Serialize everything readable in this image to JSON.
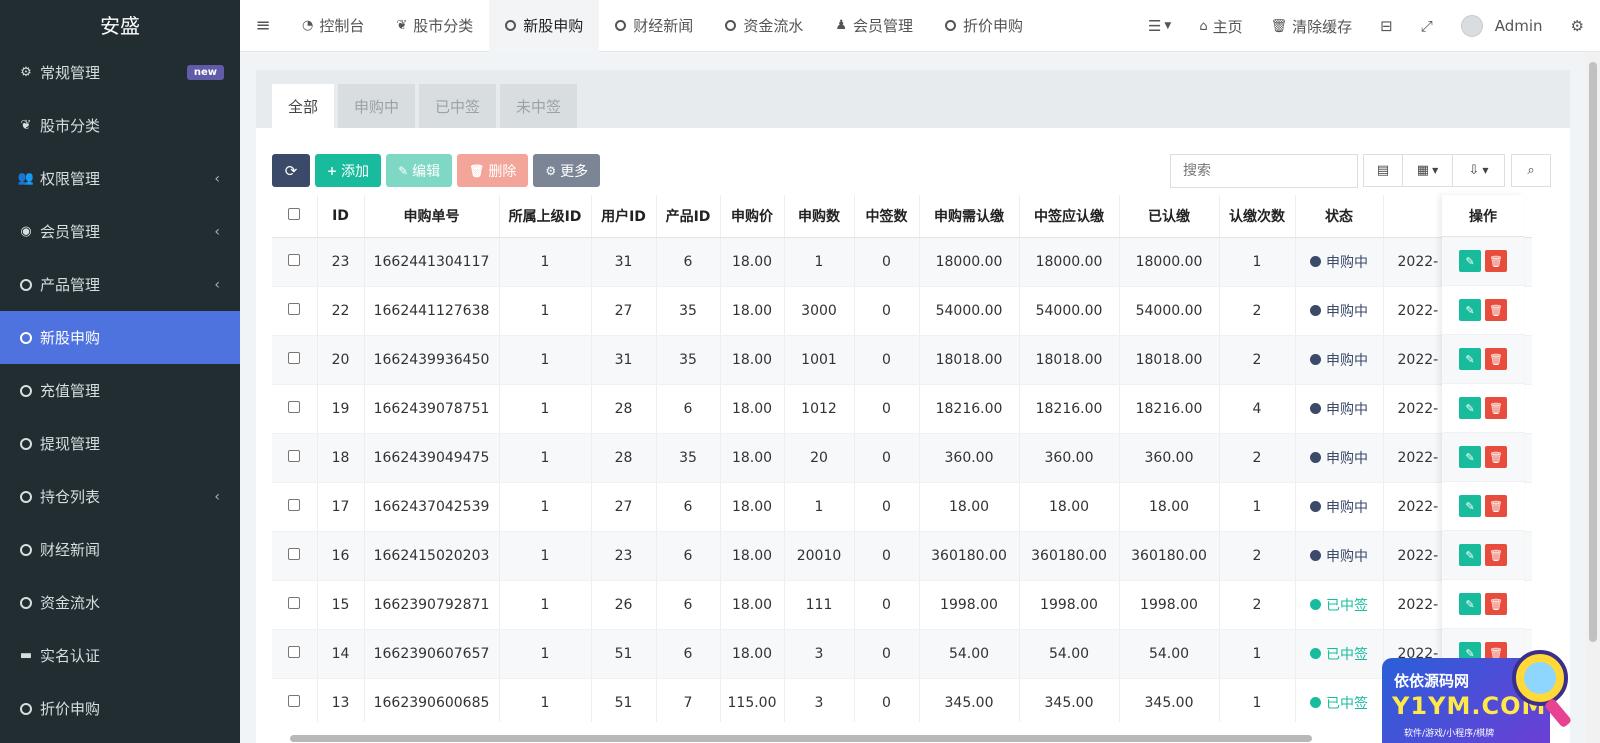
{
  "sidebar": {
    "brand": "安盛",
    "items": [
      {
        "label": "常规管理",
        "icon": "cogs-icon",
        "badge": "new"
      },
      {
        "label": "股市分类",
        "icon": "leaf-icon"
      },
      {
        "label": "权限管理",
        "icon": "group-icon",
        "chevron": true
      },
      {
        "label": "会员管理",
        "icon": "user-circle-icon",
        "chevron": true
      },
      {
        "label": "产品管理",
        "icon": "circle-o-icon",
        "chevron": true
      },
      {
        "label": "新股申购",
        "icon": "circle-o-icon",
        "active": true
      },
      {
        "label": "充值管理",
        "icon": "circle-o-icon"
      },
      {
        "label": "提现管理",
        "icon": "circle-o-icon"
      },
      {
        "label": "持仓列表",
        "icon": "circle-o-icon",
        "chevron": true
      },
      {
        "label": "财经新闻",
        "icon": "circle-o-icon"
      },
      {
        "label": "资金流水",
        "icon": "circle-o-icon"
      },
      {
        "label": "实名认证",
        "icon": "credit-card-icon"
      },
      {
        "label": "折价申购",
        "icon": "circle-o-icon"
      }
    ]
  },
  "topnav": {
    "tabs": [
      {
        "label": "控制台",
        "icon": "dashboard-icon"
      },
      {
        "label": "股市分类",
        "icon": "leaf-icon"
      },
      {
        "label": "新股申购",
        "icon": "circle-o-icon",
        "active": true
      },
      {
        "label": "财经新闻",
        "icon": "circle-o-icon"
      },
      {
        "label": "资金流水",
        "icon": "circle-o-icon"
      },
      {
        "label": "会员管理",
        "icon": "user-icon"
      },
      {
        "label": "折价申购",
        "icon": "circle-o-icon"
      }
    ],
    "home_label": "主页",
    "clear_cache_label": "清除缓存",
    "admin_label": "Admin"
  },
  "page_tabs": [
    "全部",
    "申购中",
    "已中签",
    "未中签"
  ],
  "toolbar": {
    "add_label": "添加",
    "edit_label": "编辑",
    "delete_label": "删除",
    "more_label": "更多",
    "search_placeholder": "搜索"
  },
  "table": {
    "columns": [
      "ID",
      "申购单号",
      "所属上级ID",
      "用户ID",
      "产品ID",
      "申购价",
      "申购数",
      "中签数",
      "申购需认缴",
      "中签应认缴",
      "已认缴",
      "认缴次数",
      "状态",
      ""
    ],
    "op_header": "操作",
    "rows": [
      {
        "id": "23",
        "no": "1662441304117",
        "parent": "1",
        "uid": "31",
        "pid": "6",
        "price": "18.00",
        "qty": "1",
        "won": "0",
        "need": "18000.00",
        "should": "18000.00",
        "paid": "18000.00",
        "times": "1",
        "status": "申购中",
        "status_type": "pending",
        "time": "2022-"
      },
      {
        "id": "22",
        "no": "1662441127638",
        "parent": "1",
        "uid": "27",
        "pid": "35",
        "price": "18.00",
        "qty": "3000",
        "won": "0",
        "need": "54000.00",
        "should": "54000.00",
        "paid": "54000.00",
        "times": "2",
        "status": "申购中",
        "status_type": "pending",
        "time": "2022-"
      },
      {
        "id": "20",
        "no": "1662439936450",
        "parent": "1",
        "uid": "31",
        "pid": "35",
        "price": "18.00",
        "qty": "1001",
        "won": "0",
        "need": "18018.00",
        "should": "18018.00",
        "paid": "18018.00",
        "times": "2",
        "status": "申购中",
        "status_type": "pending",
        "time": "2022-"
      },
      {
        "id": "19",
        "no": "1662439078751",
        "parent": "1",
        "uid": "28",
        "pid": "6",
        "price": "18.00",
        "qty": "1012",
        "won": "0",
        "need": "18216.00",
        "should": "18216.00",
        "paid": "18216.00",
        "times": "4",
        "status": "申购中",
        "status_type": "pending",
        "time": "2022-"
      },
      {
        "id": "18",
        "no": "1662439049475",
        "parent": "1",
        "uid": "28",
        "pid": "35",
        "price": "18.00",
        "qty": "20",
        "won": "0",
        "need": "360.00",
        "should": "360.00",
        "paid": "360.00",
        "times": "2",
        "status": "申购中",
        "status_type": "pending",
        "time": "2022-"
      },
      {
        "id": "17",
        "no": "1662437042539",
        "parent": "1",
        "uid": "27",
        "pid": "6",
        "price": "18.00",
        "qty": "1",
        "won": "0",
        "need": "18.00",
        "should": "18.00",
        "paid": "18.00",
        "times": "1",
        "status": "申购中",
        "status_type": "pending",
        "time": "2022-"
      },
      {
        "id": "16",
        "no": "1662415020203",
        "parent": "1",
        "uid": "23",
        "pid": "6",
        "price": "18.00",
        "qty": "20010",
        "won": "0",
        "need": "360180.00",
        "should": "360180.00",
        "paid": "360180.00",
        "times": "2",
        "status": "申购中",
        "status_type": "pending",
        "time": "2022-"
      },
      {
        "id": "15",
        "no": "1662390792871",
        "parent": "1",
        "uid": "26",
        "pid": "6",
        "price": "18.00",
        "qty": "111",
        "won": "0",
        "need": "1998.00",
        "should": "1998.00",
        "paid": "1998.00",
        "times": "2",
        "status": "已中签",
        "status_type": "won",
        "time": "2022-"
      },
      {
        "id": "14",
        "no": "1662390607657",
        "parent": "1",
        "uid": "51",
        "pid": "6",
        "price": "18.00",
        "qty": "3",
        "won": "0",
        "need": "54.00",
        "should": "54.00",
        "paid": "54.00",
        "times": "1",
        "status": "已中签",
        "status_type": "won",
        "time": "2022-"
      },
      {
        "id": "13",
        "no": "1662390600685",
        "parent": "1",
        "uid": "51",
        "pid": "7",
        "price": "115.00",
        "qty": "3",
        "won": "0",
        "need": "345.00",
        "should": "345.00",
        "paid": "345.00",
        "times": "1",
        "status": "已中签",
        "status_type": "won",
        "time": "2022-"
      }
    ]
  },
  "watermark": {
    "line1": "依依源码网",
    "line2": "Y1YM.COM",
    "line3": "软件/游戏/小程序/棋牌"
  },
  "colors": {
    "sidebar_bg": "#222d32",
    "active_menu": "#4e73df",
    "success": "#18bc9c",
    "danger": "#e74c3c",
    "primary_dark": "#3c4a69"
  }
}
